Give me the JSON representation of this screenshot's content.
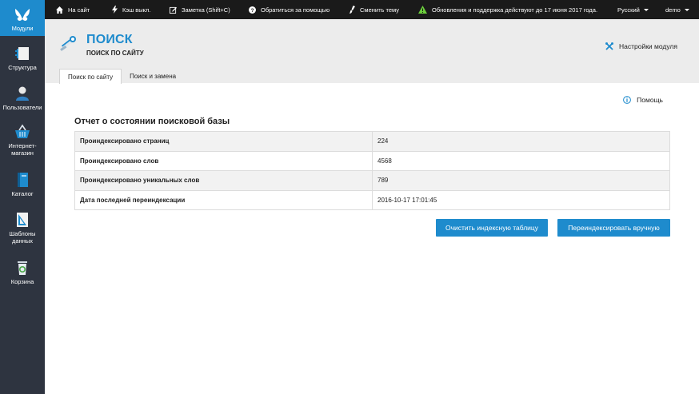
{
  "sidebar": {
    "items": [
      {
        "label": "Модули"
      },
      {
        "label": "Структура"
      },
      {
        "label": "Пользователи"
      },
      {
        "label": "Интернет-\nмагазин"
      },
      {
        "label": "Каталог"
      },
      {
        "label": "Шаблоны\nданных"
      },
      {
        "label": "Корзина"
      }
    ]
  },
  "topbar": {
    "site": "На сайт",
    "cache": "Кэш выкл.",
    "note": "Заметка (Shift+C)",
    "support": "Обратиться за помощью",
    "theme": "Сменить тему",
    "updates": "Обновления и поддержка действуют до 17 июня 2017 года.",
    "language": "Русский",
    "user": "demo"
  },
  "header": {
    "title": "ПОИСК",
    "subtitle": "ПОИСК ПО САЙТУ",
    "settings": "Настройки модуля"
  },
  "tabs": [
    {
      "label": "Поиск по сайту"
    },
    {
      "label": "Поиск и замена"
    }
  ],
  "help": "Помощь",
  "report": {
    "title": "Отчет о состоянии поисковой базы",
    "rows": [
      {
        "key": "Проиндексировано страниц",
        "value": "224"
      },
      {
        "key": "Проиндексировано слов",
        "value": "4568"
      },
      {
        "key": "Проиндексировано уникальных слов",
        "value": "789"
      },
      {
        "key": "Дата последней переиндексации",
        "value": "2016-10-17 17:01:45"
      }
    ]
  },
  "buttons": {
    "clear": "Очистить индексную таблицу",
    "reindex": "Переиндексировать вручную"
  },
  "colors": {
    "accent": "#1e8bcd",
    "sidebar": "#2e3440",
    "topbar": "#1a1a1a",
    "header": "#ececec",
    "warning": "#6ccf3c"
  }
}
